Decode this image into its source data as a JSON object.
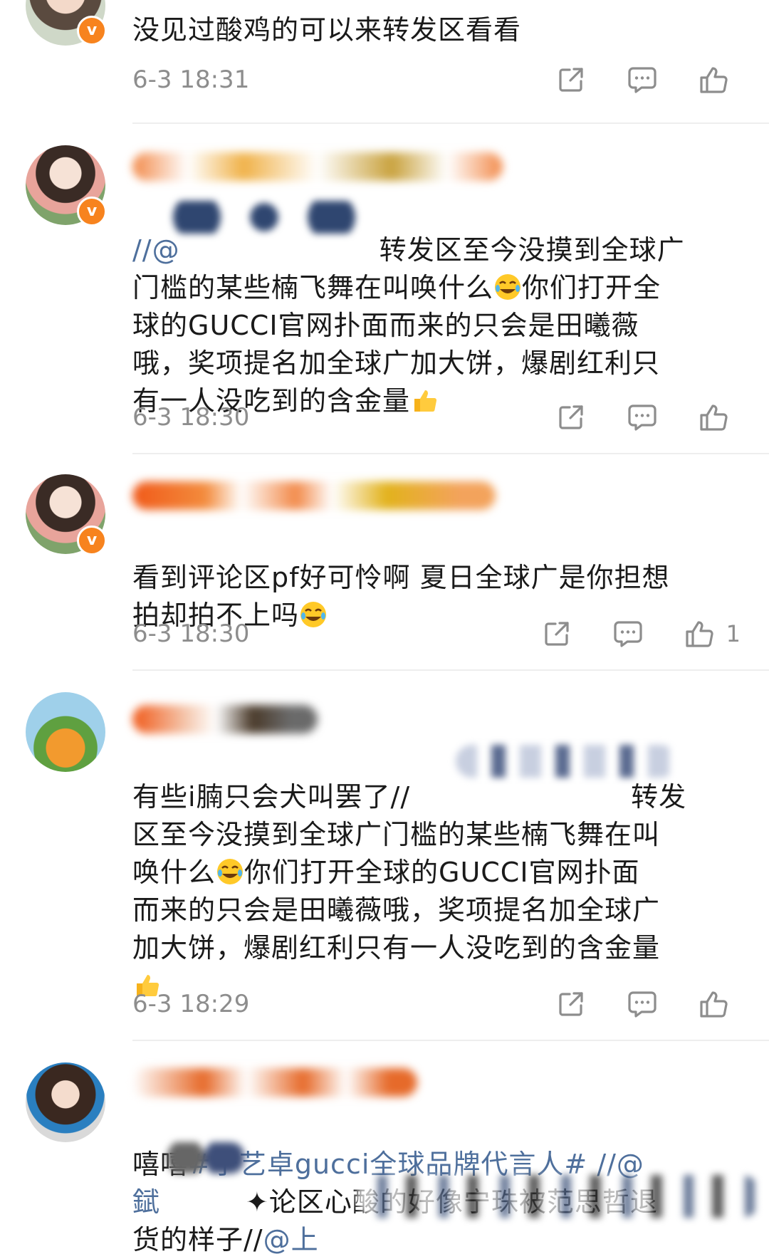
{
  "comments": [
    {
      "text": "没见过酸鸡的可以来转发区看看",
      "time": "6-3 18:31",
      "likes": ""
    },
    {
      "prefix": "//@",
      "text_a": "转发区至今没摸到全球广",
      "text_b": "门槛的某些楠飞舞在叫唤什么",
      "text_c": "你们打开全",
      "text_d": "球的GUCCI官网扑面而来的只会是田曦薇",
      "text_e": "哦，奖项提名加全球广加大饼，爆剧红利只",
      "text_f": "有一人没吃到的含金量",
      "time": "6-3 18:30",
      "likes": ""
    },
    {
      "text_a": "看到评论区pf好可怜啊 夏日全球广是你担想",
      "text_b": "拍却拍不上吗",
      "time": "6-3 18:30",
      "likes": "1"
    },
    {
      "text_a": "有些i腩只会犬叫罢了//",
      "text_a2": "转发",
      "text_b": "区至今没摸到全球广门槛的某些楠飞舞在叫",
      "text_c": "唤什么",
      "text_c2": "你们打开全球的GUCCI官网扑面",
      "text_d": "而来的只会是田曦薇哦，奖项提名加全球广",
      "text_e": "加大饼，爆剧红利只有一人没吃到的含金量",
      "time": "6-3 18:29",
      "likes": ""
    },
    {
      "text_a": "嘻嘻",
      "hashtag": "#宁艺卓gucci全球品牌代言人#",
      "text_a2": " //@",
      "text_b1": "錻",
      "text_b2": "✦论区心酸的好像宁珠被范思哲退",
      "text_c": "货的样子//",
      "mention_c": "@上"
    }
  ],
  "colors": {
    "text": "#1a1a1a",
    "meta": "#8d8d8d",
    "link": "#4e6f9c",
    "badge": "#f7831e",
    "divider": "#eeeeee"
  },
  "icons": [
    "repost-icon",
    "comment-icon",
    "like-icon",
    "verified-badge-icon",
    "laugh-cry-emoji",
    "thumbs-up-emoji"
  ]
}
